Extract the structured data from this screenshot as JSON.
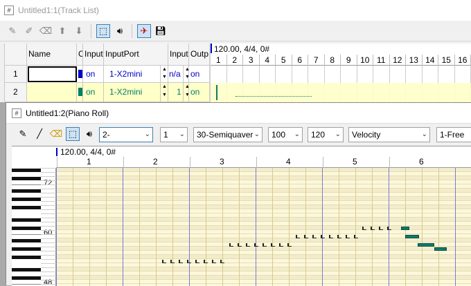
{
  "track_list": {
    "title": "Untitled1:1(Track List)",
    "headers": {
      "name": "Name",
      "c": "C",
      "input": "Input",
      "input_port": "InputPort",
      "input_ch": "Input",
      "out": "Outp"
    },
    "tempo_marker": "120.00, 4/4, 0#",
    "measures": [
      "1",
      "2",
      "3",
      "4",
      "5",
      "6",
      "7",
      "8",
      "9",
      "10",
      "11",
      "12",
      "13",
      "14",
      "15",
      "16"
    ],
    "rows": [
      {
        "num": "1",
        "input": "on",
        "port": "1-X2mini",
        "ch": "n/a",
        "out": "on"
      },
      {
        "num": "2",
        "input": "on",
        "port": "1-X2mini",
        "ch": "1",
        "out": "on"
      }
    ]
  },
  "piano_roll": {
    "title": "Untitled1:2(Piano Roll)",
    "combos": {
      "track": "2-",
      "channel": "1",
      "snap": "30-Semiquaver",
      "velocity_val": "100",
      "length_val": "120",
      "graph": "Velocity",
      "graph_kind": "1-Free"
    },
    "tempo_marker": "120.00, 4/4, 0#",
    "measures": [
      "1",
      "2",
      "3",
      "4",
      "5",
      "6"
    ],
    "key_labels": [
      "72",
      "60",
      "48"
    ]
  },
  "colors": {
    "track1_dot": "#0000c8",
    "track2_dot": "#008060",
    "note_fill": "#0f7a6a",
    "grid_bg": "#fcf8dc",
    "row_yellow": "#ffffc8"
  }
}
